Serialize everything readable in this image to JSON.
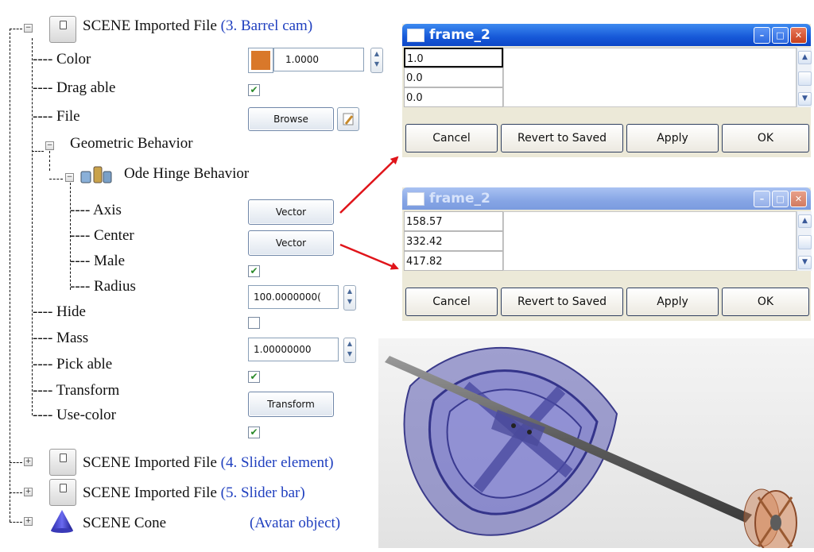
{
  "tree": {
    "root": {
      "prefix": "SCENE Imported File ",
      "highlight": "(3. Barrel cam)"
    },
    "properties": {
      "color": "---- Color",
      "dragable": "---- Drag able",
      "file": "---- File",
      "geometric": "Geometric Behavior",
      "ode": "Ode Hinge Behavior",
      "axis": "---- Axis",
      "center": "---- Center",
      "male": "---- Male",
      "radius": "---- Radius",
      "hide": "---- Hide",
      "mass": "---- Mass",
      "pickable": "---- Pick able",
      "transform": "---- Transform",
      "usecolor": "---- Use-color"
    },
    "siblings": [
      {
        "prefix": "SCENE Imported File ",
        "highlight": "(4. Slider element)"
      },
      {
        "prefix": "SCENE Imported File ",
        "highlight": "(5. Slider bar)"
      },
      {
        "prefix": "SCENE Cone",
        "highlight": "(Avatar object)"
      }
    ]
  },
  "controls": {
    "color_value": "1.0000",
    "color_swatch": "#d9782a",
    "browse_label": "Browse",
    "axis_button": "Vector",
    "center_button": "Vector",
    "radius_value": "100.0000000(",
    "mass_value": "1.00000000",
    "transform_button": "Transform",
    "dragable_checked": true,
    "male_checked": true,
    "hide_checked": false,
    "pickable_checked": true,
    "usecolor_checked": true
  },
  "dialog_top": {
    "title": "frame_2",
    "values": [
      "1.0",
      "0.0",
      "0.0"
    ],
    "buttons": [
      "Cancel",
      "Revert to Saved",
      "Apply",
      "OK"
    ]
  },
  "dialog_bottom": {
    "title": "frame_2",
    "values": [
      "158.57",
      "332.42",
      "417.82"
    ],
    "buttons": [
      "Cancel",
      "Revert to Saved",
      "Apply",
      "OK"
    ]
  },
  "colors": {
    "highlight_text": "#1f3fbf",
    "arrow": "#e0141a",
    "cam_body": "#5a5ab0",
    "shaft": "#6e6e6e",
    "roller": "#c8784a"
  }
}
